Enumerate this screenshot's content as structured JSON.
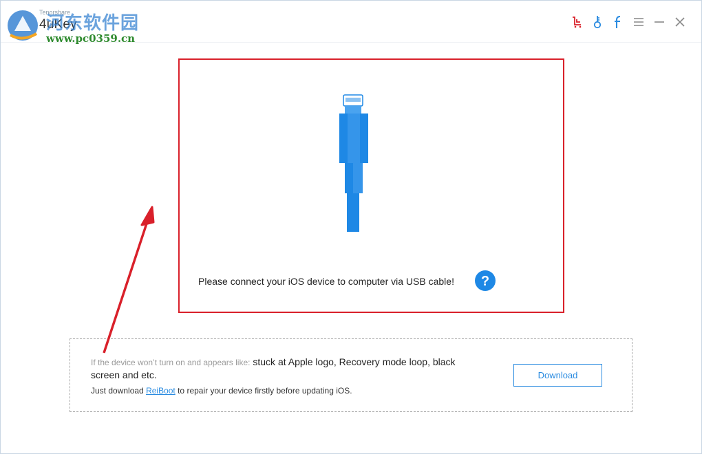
{
  "app": {
    "brand": "Tenorshare",
    "title": "4uKey"
  },
  "watermark": {
    "chinese": "河东软件园",
    "url": "www.pc0359.cn"
  },
  "titlebar_icons": [
    {
      "name": "cart-icon",
      "color": "#d9202a"
    },
    {
      "name": "key-icon",
      "color": "#2a8be0"
    },
    {
      "name": "facebook-icon",
      "color": "#2a8be0"
    },
    {
      "name": "menu-icon",
      "color": "#888888"
    },
    {
      "name": "minimize-icon",
      "color": "#888888"
    },
    {
      "name": "close-icon",
      "color": "#888888"
    }
  ],
  "connect": {
    "message": "Please connect your iOS device to computer via USB cable!",
    "help_icon": "question-circle-icon",
    "highlight_color": "#d9202a",
    "cable_color": "#1e88e5"
  },
  "tip": {
    "lead": "If the device won’t turn on and appears like:",
    "symptoms": " stuck at Apple logo, Recovery mode loop, black screen and etc.",
    "line2_prefix": "Just download ",
    "link": "ReiBoot",
    "line2_suffix": " to repair your device firstly before updating iOS.",
    "download_label": "Download"
  },
  "colors": {
    "accent": "#2a8be0",
    "annotation": "#d9202a"
  }
}
